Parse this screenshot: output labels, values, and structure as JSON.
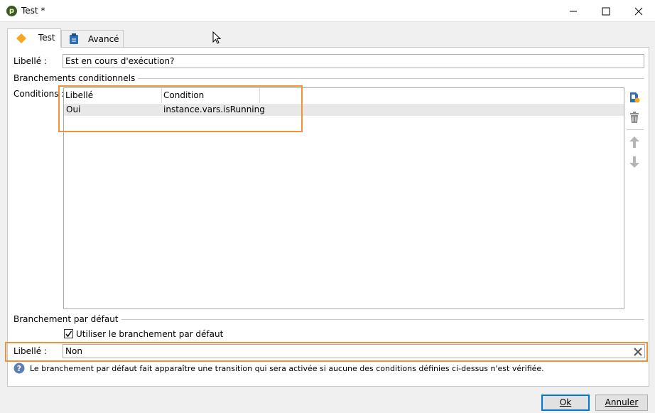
{
  "window": {
    "title": "Test *",
    "icon_glyph": "p"
  },
  "tabs": [
    {
      "label": "Test",
      "icon": "diamond-icon",
      "active": true
    },
    {
      "label": "Avancé",
      "icon": "clipboard-icon",
      "active": false
    }
  ],
  "form": {
    "label_field": {
      "label": "Libellé :",
      "value": "Est en cours d'exécution?"
    },
    "conditional_section": {
      "title": "Branchements conditionnels"
    },
    "conditions": {
      "label": "Conditions :",
      "columns": [
        "Libellé",
        "Condition"
      ],
      "rows": [
        {
          "label": "Oui",
          "condition": "instance.vars.isRunning"
        }
      ]
    },
    "default_section": {
      "title": "Branchement par défaut"
    },
    "use_default": {
      "label": "Utiliser le branchement par défaut",
      "checked": true
    },
    "default_label_field": {
      "label": "Libellé :",
      "value": "Non"
    },
    "help_text": "Le branchement par défaut fait apparaître une transition qui sera activée si aucune des conditions définies ci-dessus n'est vérifiée."
  },
  "buttons": {
    "ok": "Ok",
    "cancel": "Annuler"
  },
  "colors": {
    "highlight": "#f0923a",
    "tab_icon_orange": "#f5a623",
    "primary_border": "#0078d7",
    "help_icon": "#5b7fb5"
  }
}
